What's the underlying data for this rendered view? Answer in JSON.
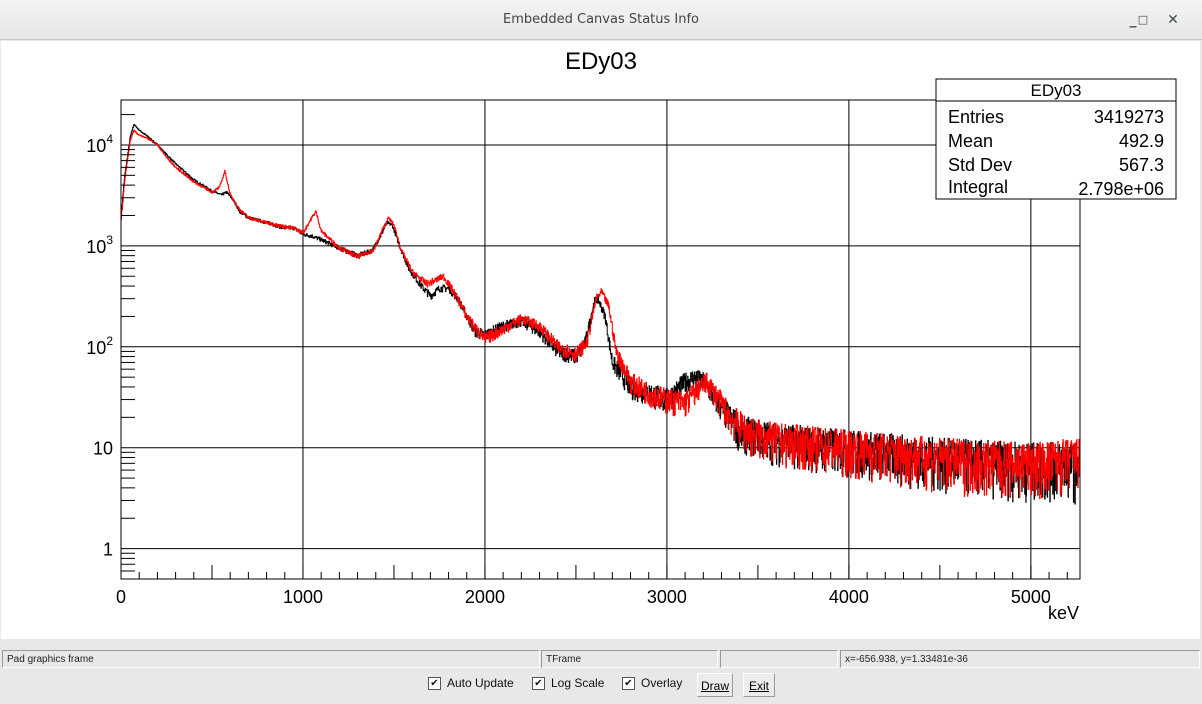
{
  "window": {
    "title": "Embedded Canvas Status Info"
  },
  "status": {
    "object": "Pad graphics frame",
    "class": "TFrame",
    "extra": "",
    "coords": "x=-656.938, y=1.33481e-36"
  },
  "controls": {
    "auto_update": "Auto Update",
    "log_scale": "Log Scale",
    "overlay": "Overlay",
    "draw": "Draw",
    "exit": "Exit",
    "auto_update_checked": true,
    "log_scale_checked": true,
    "overlay_checked": true
  },
  "stats": {
    "title": "EDy03",
    "rows": [
      {
        "label": "Entries",
        "value": "3419273"
      },
      {
        "label": "Mean",
        "value": "492.9"
      },
      {
        "label": "Std Dev",
        "value": "567.3"
      },
      {
        "label": "Integral",
        "value": "2.798e+06"
      }
    ]
  },
  "chart_data": {
    "type": "line",
    "title": "EDy03",
    "xlabel": "keV",
    "ylabel": "",
    "xlim": [
      0,
      5270
    ],
    "ylim": [
      0.5,
      27900
    ],
    "yscale": "log",
    "grid": true,
    "xticks": [
      "0",
      "1000",
      "2000",
      "3000",
      "4000",
      "5000"
    ],
    "xtick_values": [
      0,
      1000,
      2000,
      3000,
      4000,
      5000
    ],
    "yticks": [
      "1",
      "10",
      "10^2",
      "10^3",
      "10^4"
    ],
    "ytick_values": [
      1,
      10,
      100,
      1000,
      10000
    ],
    "series": [
      {
        "name": "black",
        "color": "#000000",
        "x": [
          0,
          20,
          50,
          70,
          100,
          150,
          200,
          250,
          300,
          400,
          500,
          550,
          580,
          620,
          650,
          700,
          800,
          900,
          950,
          1000,
          1050,
          1100,
          1200,
          1300,
          1380,
          1430,
          1460,
          1490,
          1530,
          1580,
          1650,
          1700,
          1750,
          1800,
          1850,
          1900,
          1950,
          2000,
          2100,
          2200,
          2300,
          2400,
          2500,
          2550,
          2600,
          2620,
          2660,
          2700,
          2800,
          2900,
          3000,
          3100,
          3150,
          3200,
          3300,
          3400,
          3600,
          4000,
          4500,
          5000,
          5260
        ],
        "y": [
          2000,
          5000,
          12000,
          16000,
          14000,
          12000,
          10000,
          8000,
          6500,
          4500,
          3500,
          3200,
          3400,
          2800,
          2200,
          1900,
          1700,
          1500,
          1500,
          1300,
          1250,
          1150,
          950,
          800,
          900,
          1300,
          1700,
          1600,
          1000,
          600,
          400,
          320,
          380,
          380,
          300,
          200,
          140,
          130,
          160,
          180,
          140,
          90,
          80,
          110,
          280,
          300,
          200,
          70,
          40,
          35,
          30,
          45,
          50,
          45,
          25,
          15,
          12,
          10,
          8,
          7,
          7
        ]
      },
      {
        "name": "red",
        "color": "#ff0000",
        "x": [
          0,
          20,
          50,
          70,
          100,
          150,
          200,
          250,
          300,
          400,
          500,
          540,
          570,
          600,
          650,
          700,
          800,
          900,
          950,
          1000,
          1040,
          1070,
          1100,
          1200,
          1300,
          1390,
          1440,
          1470,
          1500,
          1540,
          1600,
          1680,
          1720,
          1770,
          1800,
          1850,
          1900,
          1950,
          2000,
          2100,
          2200,
          2300,
          2400,
          2500,
          2560,
          2610,
          2640,
          2680,
          2720,
          2800,
          2900,
          3000,
          3100,
          3180,
          3220,
          3260,
          3350,
          3450,
          3600,
          4000,
          4500,
          5000,
          5260
        ],
        "y": [
          1800,
          4500,
          11000,
          14000,
          12500,
          11500,
          10000,
          7500,
          6000,
          4300,
          3400,
          3800,
          5500,
          3200,
          2300,
          1900,
          1700,
          1550,
          1500,
          1350,
          1800,
          2200,
          1400,
          950,
          780,
          920,
          1500,
          1900,
          1600,
          900,
          550,
          420,
          450,
          500,
          420,
          300,
          200,
          150,
          120,
          150,
          190,
          160,
          100,
          85,
          110,
          300,
          350,
          250,
          90,
          45,
          35,
          30,
          28,
          40,
          45,
          35,
          20,
          14,
          12,
          10,
          8,
          7,
          8
        ]
      }
    ]
  }
}
